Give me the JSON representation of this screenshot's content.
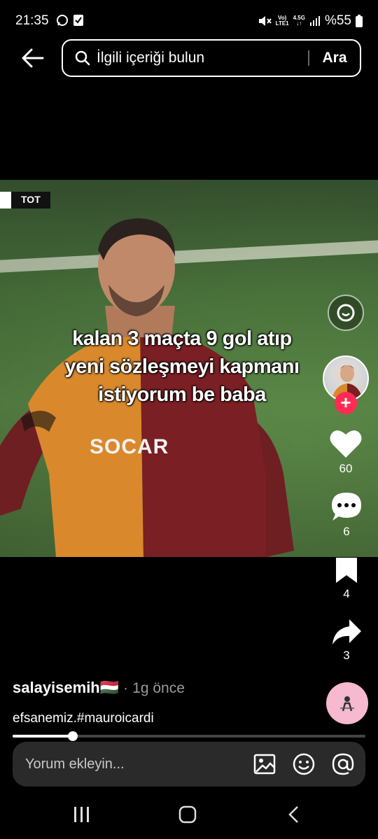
{
  "status_bar": {
    "time": "21:35",
    "network_top": "Vo)",
    "network_bottom": "LTE1",
    "network_gen": "4.5G",
    "battery": "%55"
  },
  "search": {
    "placeholder": "İlgili içeriği bulun",
    "submit_label": "Ara"
  },
  "video": {
    "score_team": "TOT",
    "caption_lines": [
      "kalan 3 maçta 9 gol atıp",
      "yeni sözleşmeyi kapmanı",
      "istiyorum be baba"
    ],
    "sponsor": "SOCAR"
  },
  "actions": {
    "likes": "60",
    "comments": "6",
    "saves": "4",
    "shares": "3"
  },
  "post": {
    "username": "salayisemih🇭🇺",
    "separator": "·",
    "time_ago": "1g önce",
    "caption": "efsanemiz.#mauroicardi",
    "progress": 0.17
  },
  "comment_bar": {
    "placeholder": "Yorum ekleyin..."
  },
  "colors": {
    "accent": "#fe2c55",
    "background": "#000000",
    "comment_bar": "#2a2a2a"
  },
  "icons": [
    "back-arrow-icon",
    "search-icon",
    "lens-icon",
    "heart-icon",
    "comment-icon",
    "bookmark-icon",
    "share-icon",
    "image-icon",
    "emoji-icon",
    "mention-icon",
    "recents-icon",
    "home-icon",
    "back-nav-icon"
  ]
}
